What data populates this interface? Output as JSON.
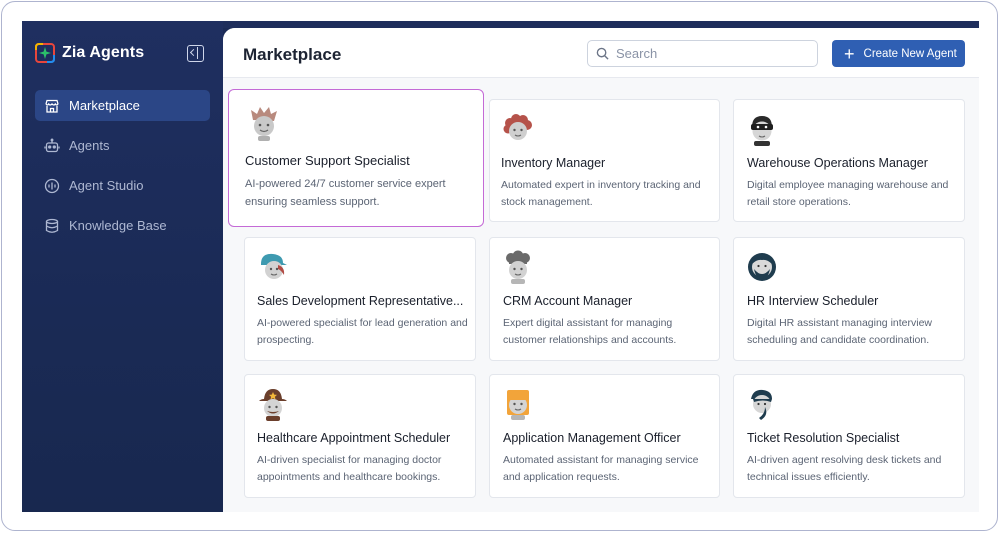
{
  "app": {
    "name": "Zia Agents"
  },
  "sidebar": {
    "items": [
      {
        "label": "Marketplace",
        "icon": "storefront-icon",
        "active": true
      },
      {
        "label": "Agents",
        "icon": "robot-icon",
        "active": false
      },
      {
        "label": "Agent Studio",
        "icon": "waveform-icon",
        "active": false
      },
      {
        "label": "Knowledge Base",
        "icon": "database-icon",
        "active": false
      }
    ]
  },
  "header": {
    "title": "Marketplace",
    "search_placeholder": "Search",
    "create_button": "Create New Agent"
  },
  "cards": [
    {
      "title": "Customer Support Specialist",
      "desc": "AI-powered 24/7 customer service expert ensuring seamless support.",
      "avatar": "spiky-hair-avatar-icon"
    },
    {
      "title": "Inventory Manager",
      "desc": "Automated expert in inventory tracking and stock management.",
      "avatar": "curly-hair-avatar-icon"
    },
    {
      "title": "Warehouse Operations Manager",
      "desc": "Digital employee managing warehouse and retail store operations.",
      "avatar": "masked-avatar-icon"
    },
    {
      "title": "Sales Development Representative...",
      "desc": "AI-powered specialist for lead generation and prospecting.",
      "avatar": "cap-avatar-icon"
    },
    {
      "title": "CRM Account Manager",
      "desc": "Expert digital assistant for managing customer relationships and accounts.",
      "avatar": "chef-hat-avatar-icon"
    },
    {
      "title": "HR Interview Scheduler",
      "desc": "Digital HR assistant managing interview scheduling and candidate coordination.",
      "avatar": "bearded-avatar-icon"
    },
    {
      "title": "Healthcare Appointment Scheduler",
      "desc": "AI-driven specialist for managing doctor appointments and healthcare bookings.",
      "avatar": "sheriff-avatar-icon"
    },
    {
      "title": "Application Management Officer",
      "desc": "Automated assistant for managing service and application requests.",
      "avatar": "orange-hair-avatar-icon"
    },
    {
      "title": "Ticket Resolution Specialist",
      "desc": "AI-driven agent resolving desk tickets and technical issues efficiently.",
      "avatar": "side-part-avatar-icon"
    }
  ],
  "colors": {
    "sidebar": "#1b2b57",
    "accent": "#2f5fb3",
    "selected_border": "#c46ad6"
  }
}
